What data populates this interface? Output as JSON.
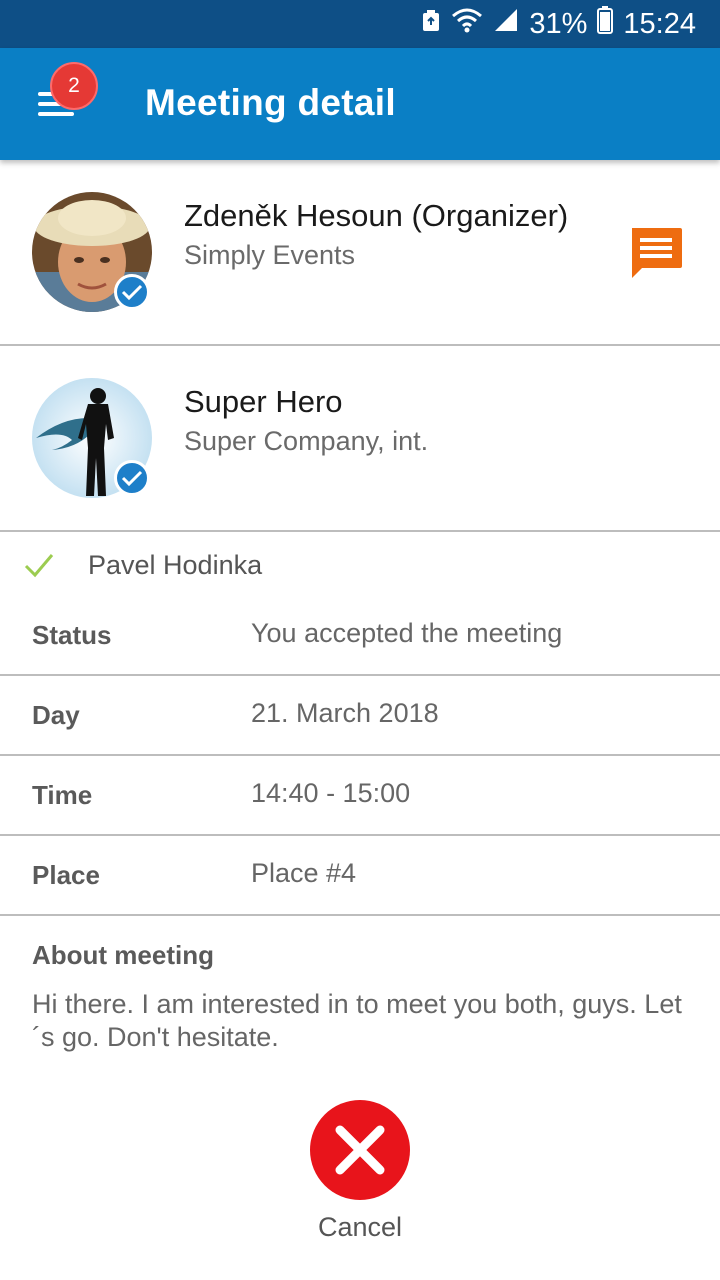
{
  "status_bar": {
    "battery": "31%",
    "time": "15:24"
  },
  "app_bar": {
    "title": "Meeting detail",
    "menu_icon": "hamburger-menu-icon",
    "badge_count": "2"
  },
  "participants": [
    {
      "name": "Zdeněk Hesoun (Organizer)",
      "company": "Simply Events",
      "avatar": "person-in-straw-hat-photo",
      "verified": true,
      "action_icon": "chat-bubble-icon"
    },
    {
      "name": "Super Hero",
      "company": "Super Company, int.",
      "avatar": "superhero-silhouette-image",
      "verified": true
    }
  ],
  "attendee": {
    "name": "Pavel Hodinka",
    "icon": "checkmark-icon"
  },
  "details": [
    {
      "label": "Status",
      "value": "You accepted the meeting"
    },
    {
      "label": "Day",
      "value": "21. March 2018"
    },
    {
      "label": "Time",
      "value": "14:40 - 15:00"
    },
    {
      "label": "Place",
      "value": "Place #4"
    }
  ],
  "about": {
    "label": "About meeting",
    "text": "Hi there. I am interested in to meet you both, guys. Let´s go. Don't hesitate."
  },
  "cancel": {
    "label": "Cancel",
    "icon": "close-x-icon"
  },
  "colors": {
    "status_bar": "#0e4f86",
    "app_bar": "#0a7fc5",
    "badge": "#e53935",
    "chat": "#ee6c10",
    "check": "#9ccc50",
    "cancel": "#e8141b"
  }
}
